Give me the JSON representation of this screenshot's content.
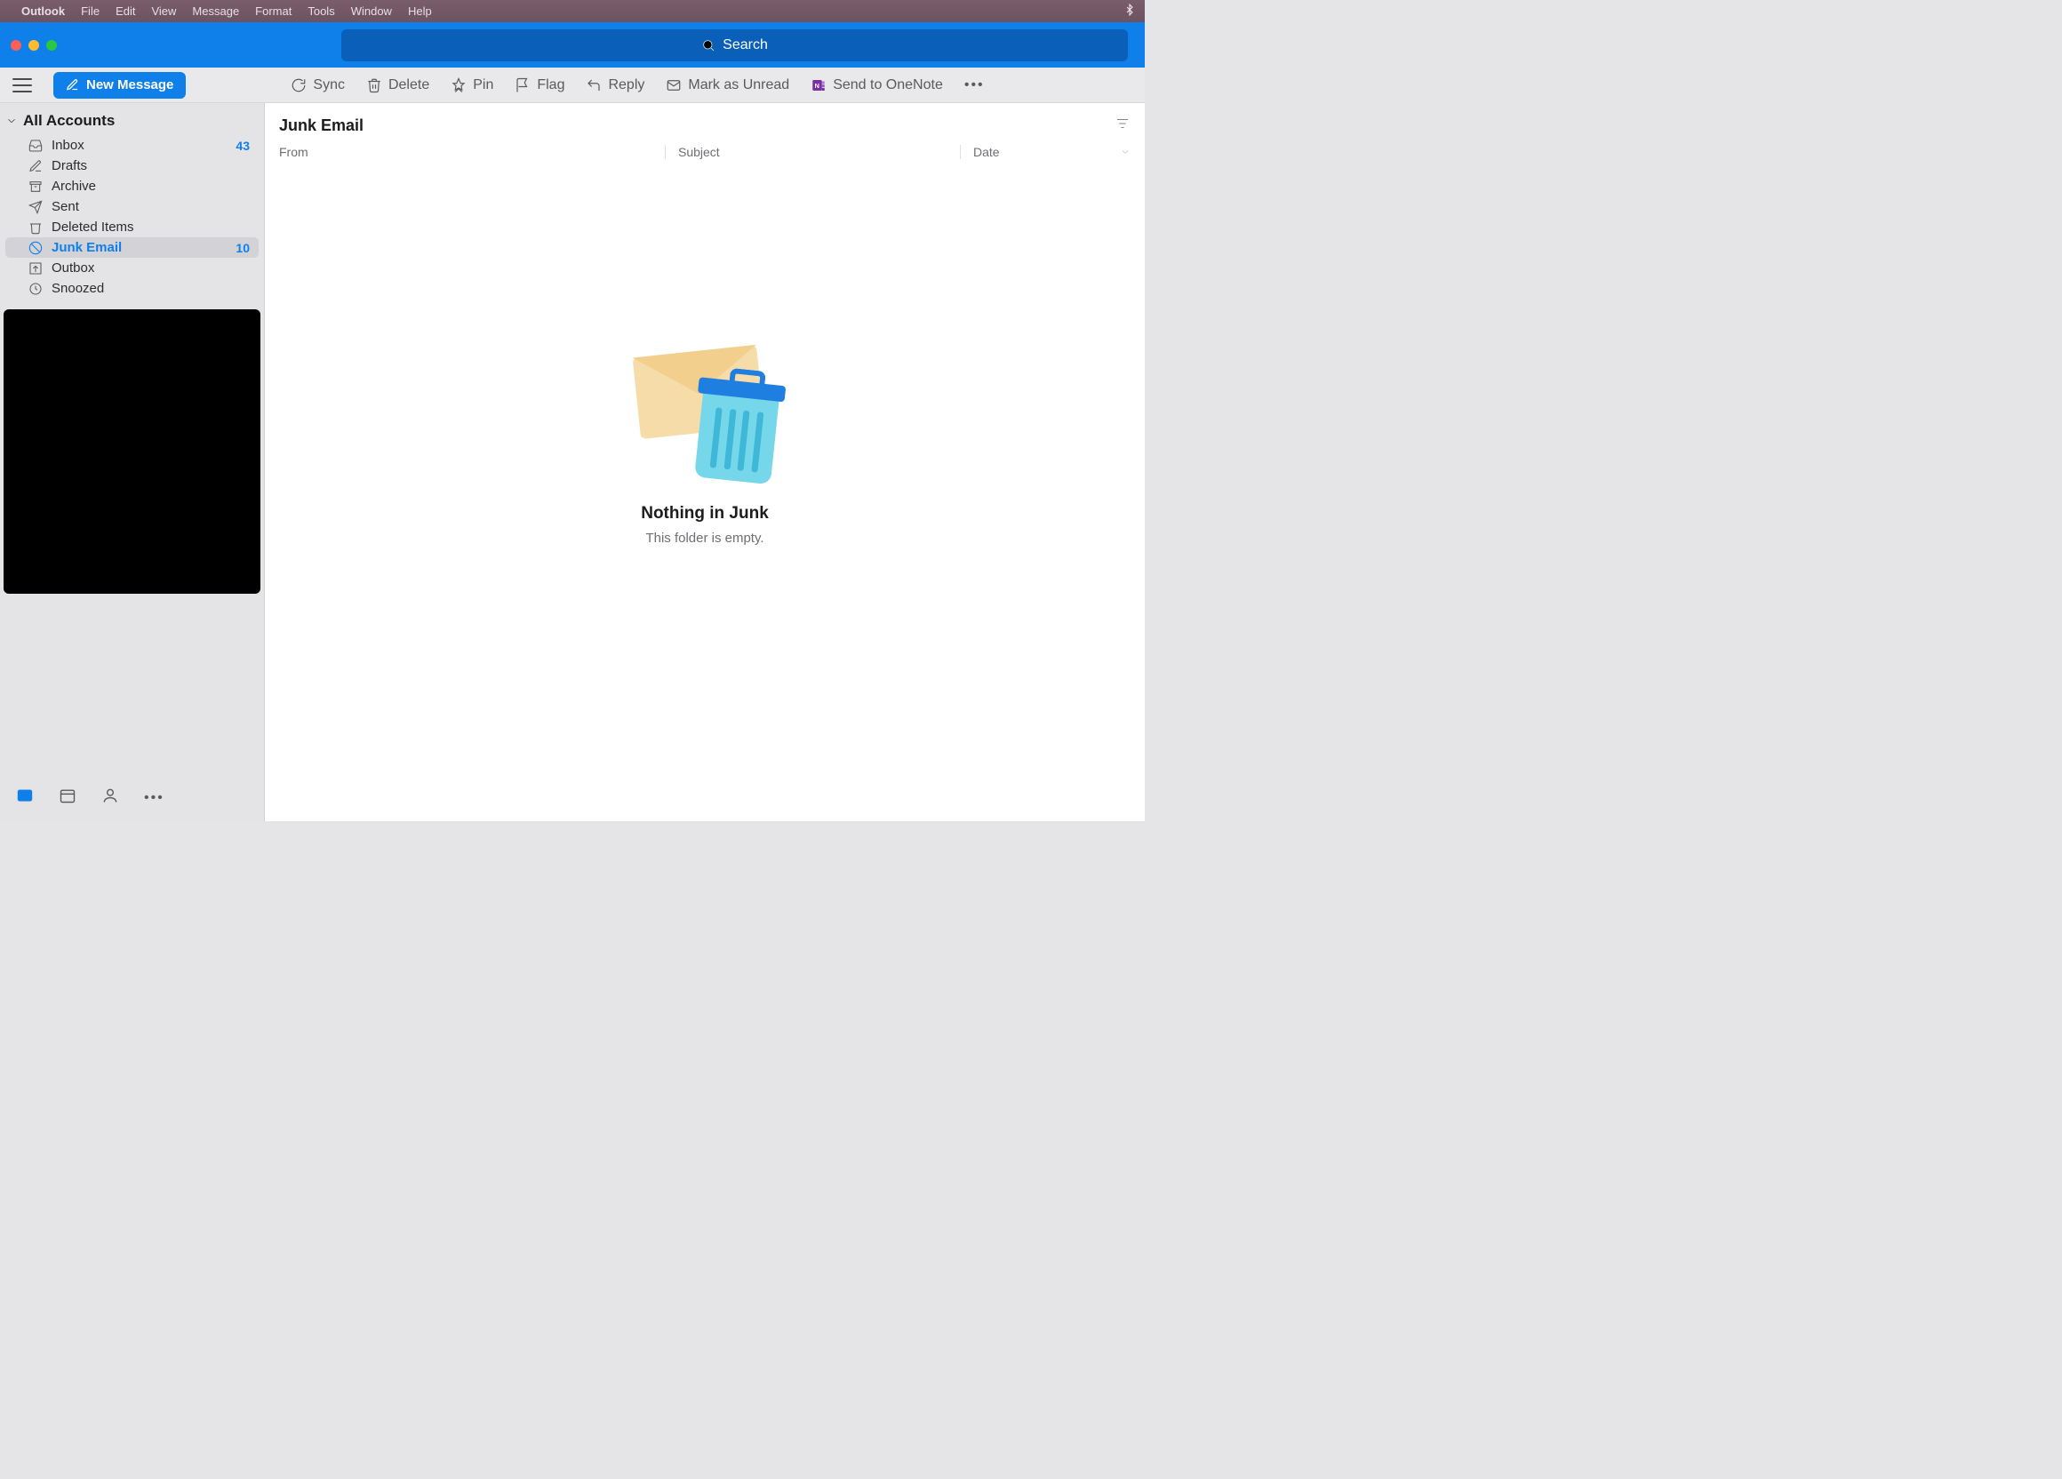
{
  "menubar": {
    "app": "Outlook",
    "items": [
      "File",
      "Edit",
      "View",
      "Message",
      "Format",
      "Tools",
      "Window",
      "Help"
    ]
  },
  "titlebar": {
    "search_placeholder": "Search"
  },
  "toolbar": {
    "new_message": "New Message",
    "sync": "Sync",
    "delete": "Delete",
    "pin": "Pin",
    "flag": "Flag",
    "reply": "Reply",
    "mark_unread": "Mark as Unread",
    "send_onenote": "Send to OneNote"
  },
  "sidebar": {
    "header": "All Accounts",
    "folders": [
      {
        "label": "Inbox",
        "count": "43"
      },
      {
        "label": "Drafts",
        "count": ""
      },
      {
        "label": "Archive",
        "count": ""
      },
      {
        "label": "Sent",
        "count": ""
      },
      {
        "label": "Deleted Items",
        "count": ""
      },
      {
        "label": "Junk Email",
        "count": "10"
      },
      {
        "label": "Outbox",
        "count": ""
      },
      {
        "label": "Snoozed",
        "count": ""
      }
    ]
  },
  "content": {
    "title": "Junk Email",
    "columns": {
      "from": "From",
      "subject": "Subject",
      "date": "Date"
    },
    "empty_title": "Nothing in Junk",
    "empty_body": "This folder is empty."
  }
}
